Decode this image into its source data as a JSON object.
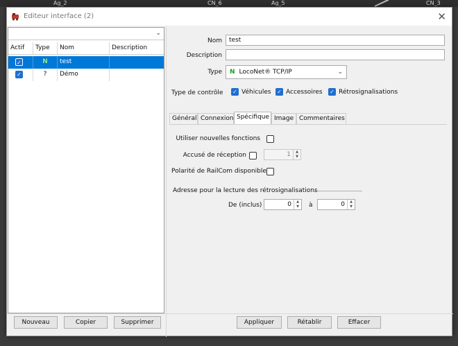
{
  "background": {
    "labels": [
      {
        "text": "Ag_2"
      },
      {
        "text": "CN_6"
      },
      {
        "text": "Ag_5"
      },
      {
        "text": "CN_3"
      }
    ]
  },
  "window": {
    "title": "Editeur interface (2)",
    "close_glyph": "✕"
  },
  "left": {
    "filter_value": "",
    "columns": [
      "Actif",
      "Type",
      "Nom",
      "Description"
    ],
    "rows": [
      {
        "active": true,
        "type": "N",
        "type_color": "#1a9e1a",
        "name": "test",
        "description": "",
        "selected": true
      },
      {
        "active": true,
        "type": "?",
        "type_color": "#111111",
        "name": "Démo",
        "description": "",
        "selected": false
      }
    ],
    "buttons": {
      "new": "Nouveau",
      "copy": "Copier",
      "delete": "Supprimer"
    }
  },
  "form": {
    "name_label": "Nom",
    "name_value": "test",
    "description_label": "Description",
    "description_value": "",
    "type_label": "Type",
    "type_badge": "N",
    "type_value": "LocoNet® TCP/IP",
    "control_label": "Type de contrôle",
    "control_options": [
      {
        "label": "Véhicules",
        "checked": true
      },
      {
        "label": "Accessoires",
        "checked": true
      },
      {
        "label": "Rétrosignalisations",
        "checked": true
      }
    ]
  },
  "tabs": [
    "Général",
    "Connexion",
    "Spécifique",
    "Image",
    "Commentaires"
  ],
  "active_tab": "Spécifique",
  "specific": {
    "new_functions_label": "Utiliser nouvelles fonctions",
    "ack_label": "Accusé de réception",
    "ack_value": "1",
    "railcom_label": "Polarité de RailCom disponible",
    "group_title": "Adresse pour la lecture des rétrosignalisations",
    "from_label": "De (inclus)",
    "from_value": "0",
    "to_label": "à",
    "to_value": "0"
  },
  "footer": {
    "apply": "Appliquer",
    "restore": "Rétablir",
    "clear": "Effacer"
  },
  "colors": {
    "selection": "#0078d7",
    "checkbox": "#1f6fd0",
    "type_n": "#1a9e1a"
  }
}
